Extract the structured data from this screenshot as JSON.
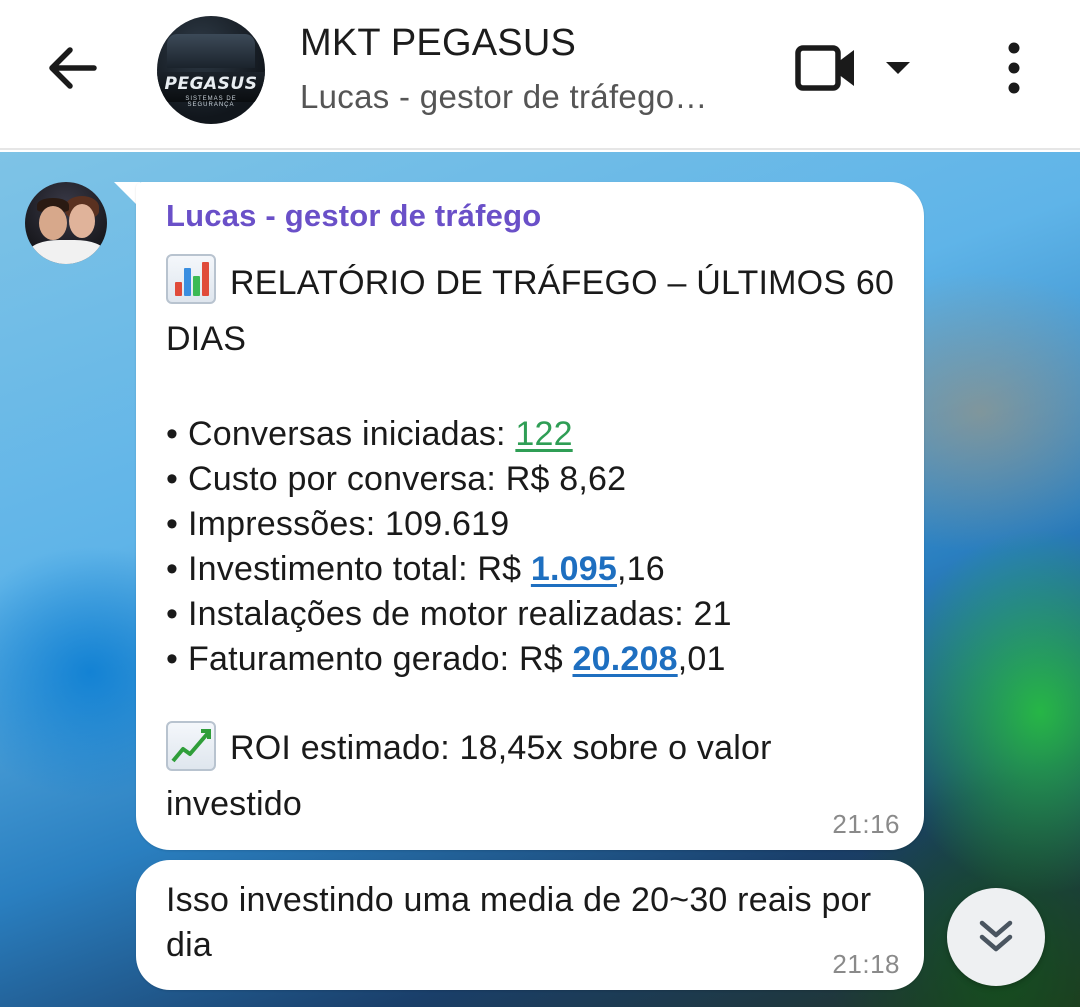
{
  "header": {
    "title": "MKT PEGASUS",
    "subtitle": "Lucas - gestor de tráfego…",
    "avatar_logo_text": "PEGASUS",
    "avatar_logo_sub": "SISTEMAS DE SEGURANÇA",
    "icons": {
      "back": "arrow-left-icon",
      "video": "video-camera-icon",
      "dropdown": "caret-down-icon",
      "menu": "more-vertical-icon"
    }
  },
  "messages": [
    {
      "sender": "Lucas - gestor de tráfego",
      "title": "RELATÓRIO DE TRÁFEGO – ÚLTIMOS 60 DIAS",
      "title_emoji": "bar-chart-emoji",
      "items": [
        {
          "label": "Conversas iniciadas: ",
          "value": "122"
        },
        {
          "label": "Custo por conversa: R$ 8,62"
        },
        {
          "label": "Impressões: 109.619"
        },
        {
          "label": "Investimento total: R$ ",
          "link": "1.095",
          "suffix": ",16"
        },
        {
          "label": "Instalações de motor realizadas: 21"
        },
        {
          "label": "Faturamento gerado: R$ ",
          "link": "20.208",
          "suffix": ",01"
        }
      ],
      "roi_emoji": "chart-increasing-emoji",
      "roi_text": "ROI estimado: 18,45x sobre o valor investido",
      "time": "21:16"
    },
    {
      "text": "Isso investindo uma media de 20~30 reais por dia",
      "time": "21:18"
    }
  ],
  "colors": {
    "sender_name": "#6a50c8",
    "link_green": "#2f9e55",
    "link_blue": "#1e6fc0",
    "bubble": "#ffffff"
  },
  "scroll_button_icon": "double-chevron-down-icon"
}
